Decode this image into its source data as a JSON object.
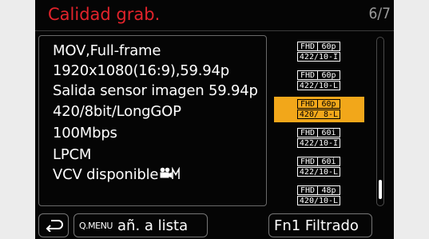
{
  "header": {
    "title": "Calidad grab.",
    "page_indicator": "6/7"
  },
  "info": {
    "lines": [
      "MOV,Full-frame",
      "1920x1080(16:9),59.94p",
      "Salida sensor imagen 59.94p",
      "420/8bit/LongGOP",
      "100Mbps",
      "LPCM",
      "VCV disponible"
    ],
    "vcv_icon": "movie-camera-m-icon"
  },
  "options": [
    {
      "res": "FHD",
      "fps": "60p",
      "fmt": "422/10-I",
      "selected": false
    },
    {
      "res": "FHD",
      "fps": "60p",
      "fmt": "422/10-L",
      "selected": false
    },
    {
      "res": "FHD",
      "fps": "60p",
      "fmt": "420/ 8-L",
      "selected": true
    },
    {
      "res": "FHD",
      "fps": "60i",
      "fmt": "422/10-I",
      "selected": false
    },
    {
      "res": "FHD",
      "fps": "60i",
      "fmt": "422/10-L",
      "selected": false
    },
    {
      "res": "FHD",
      "fps": "48p",
      "fmt": "420/10-L",
      "selected": false
    }
  ],
  "footer": {
    "back_icon": "return-arrow-icon",
    "qmenu_prefix": "Q.MENU",
    "add_label": "añ. a lista",
    "filter_label": "Fn1 Filtrado"
  },
  "colors": {
    "title": "#e3232b",
    "selected": "#f2a71a",
    "background": "#050505"
  },
  "scroll": {
    "position_fraction": 0.85
  }
}
